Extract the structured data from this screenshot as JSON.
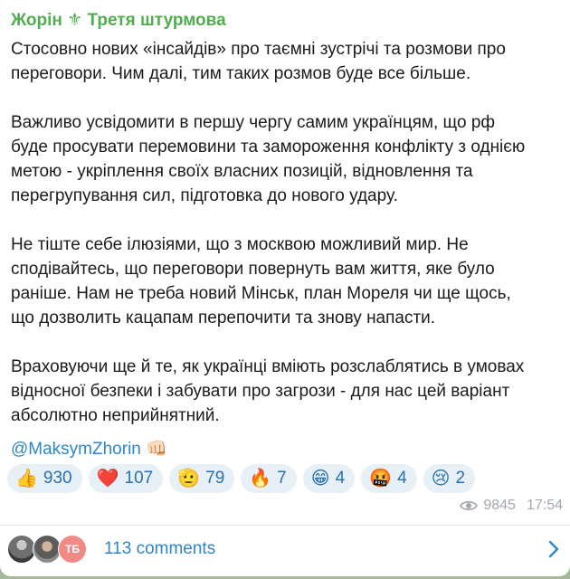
{
  "post": {
    "author": "Жорін ⚜ Третя штурмова",
    "paragraphs": [
      "Стосовно нових «інсайдів» про таємні зустрічі та розмови про\nпереговори. Чим далі, тим таких розмов буде все більше.",
      "Важливо усвідомити в першу чергу самим українцям, що рф\nбуде просувати перемовини та замороження конфлікту з однією\nметою - укріплення своїх власних позицій, відновлення та\nперегрупування сил, підготовка до нового удару.",
      "Не тіште себе ілюзіями, що з москвою можливий мир. Не\nсподівайтесь, що переговори повернуть вам життя, яке було\nраніше. Нам не треба новий Мінськ, план Мореля чи ще щось,\nщо дозволить кацапам перепочити та знову напасти.",
      "Враховуючи ще й те, як українці вміють розслаблятись в умовах\nвідносної безпеки і забувати про загрози - для нас цей варіант\nабсолютно неприйнятний."
    ],
    "signature": {
      "mention": "@MaksymZhorin",
      "emoji": "👊🏻"
    },
    "reactions": [
      {
        "emoji": "👍",
        "count": "930"
      },
      {
        "emoji": "❤️",
        "count": "107"
      },
      {
        "emoji": "🫡",
        "count": "79"
      },
      {
        "emoji": "🔥",
        "count": "7"
      },
      {
        "emoji": "😁",
        "count": "4"
      },
      {
        "emoji": "🤬",
        "count": "4"
      },
      {
        "emoji": "😢",
        "count": "2"
      }
    ],
    "views": "9845",
    "time": "17:54"
  },
  "comments": {
    "avatar_initials": "ТБ",
    "label": "113 comments"
  },
  "colors": {
    "author": "#4fae4e",
    "link": "#2f86c8",
    "reaction_bg": "#e7f0f6",
    "reaction_text": "#2a6fae",
    "meta": "#a3a9ae",
    "background": "#a8b89a"
  },
  "icons": {
    "views": "eye-icon",
    "comments_arrow": "chevron-right-icon"
  }
}
